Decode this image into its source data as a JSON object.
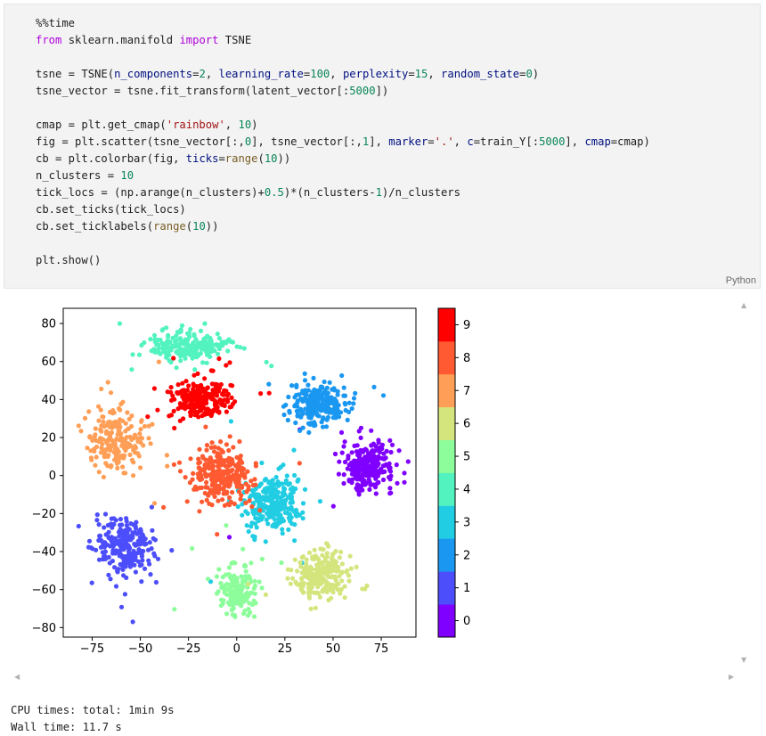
{
  "cell": {
    "language": "Python",
    "lines": [
      [
        {
          "t": "%%time",
          "c": ""
        }
      ],
      [
        {
          "t": "from",
          "c": "kw"
        },
        {
          "t": " sklearn.manifold ",
          "c": ""
        },
        {
          "t": "import",
          "c": "kw"
        },
        {
          "t": " TSNE",
          "c": ""
        }
      ],
      [],
      [
        {
          "t": "tsne = TSNE(",
          "c": ""
        },
        {
          "t": "n_components",
          "c": "nm"
        },
        {
          "t": "=",
          "c": ""
        },
        {
          "t": "2",
          "c": "num"
        },
        {
          "t": ", ",
          "c": ""
        },
        {
          "t": "learning_rate",
          "c": "nm"
        },
        {
          "t": "=",
          "c": ""
        },
        {
          "t": "100",
          "c": "num"
        },
        {
          "t": ", ",
          "c": ""
        },
        {
          "t": "perplexity",
          "c": "nm"
        },
        {
          "t": "=",
          "c": ""
        },
        {
          "t": "15",
          "c": "num"
        },
        {
          "t": ", ",
          "c": ""
        },
        {
          "t": "random_state",
          "c": "nm"
        },
        {
          "t": "=",
          "c": ""
        },
        {
          "t": "0",
          "c": "num"
        },
        {
          "t": ")",
          "c": ""
        }
      ],
      [
        {
          "t": "tsne_vector = tsne.fit_transform(latent_vector[:",
          "c": ""
        },
        {
          "t": "5000",
          "c": "num"
        },
        {
          "t": "])",
          "c": ""
        }
      ],
      [],
      [
        {
          "t": "cmap = plt.get_cmap(",
          "c": ""
        },
        {
          "t": "'rainbow'",
          "c": "str"
        },
        {
          "t": ", ",
          "c": ""
        },
        {
          "t": "10",
          "c": "num"
        },
        {
          "t": ")",
          "c": ""
        }
      ],
      [
        {
          "t": "fig = plt.scatter(tsne_vector[:,",
          "c": ""
        },
        {
          "t": "0",
          "c": "num"
        },
        {
          "t": "], tsne_vector[:,",
          "c": ""
        },
        {
          "t": "1",
          "c": "num"
        },
        {
          "t": "], ",
          "c": ""
        },
        {
          "t": "marker",
          "c": "nm"
        },
        {
          "t": "=",
          "c": ""
        },
        {
          "t": "'.'",
          "c": "str"
        },
        {
          "t": ", ",
          "c": ""
        },
        {
          "t": "c",
          "c": "nm"
        },
        {
          "t": "=train_Y[:",
          "c": ""
        },
        {
          "t": "5000",
          "c": "num"
        },
        {
          "t": "], ",
          "c": ""
        },
        {
          "t": "cmap",
          "c": "nm"
        },
        {
          "t": "=cmap)",
          "c": ""
        }
      ],
      [
        {
          "t": "cb = plt.colorbar(fig, ",
          "c": ""
        },
        {
          "t": "ticks",
          "c": "nm"
        },
        {
          "t": "=",
          "c": ""
        },
        {
          "t": "range",
          "c": "fn"
        },
        {
          "t": "(",
          "c": ""
        },
        {
          "t": "10",
          "c": "num"
        },
        {
          "t": "))",
          "c": ""
        }
      ],
      [
        {
          "t": "n_clusters = ",
          "c": ""
        },
        {
          "t": "10",
          "c": "num"
        }
      ],
      [
        {
          "t": "tick_locs = (np.arange(n_clusters)+",
          "c": ""
        },
        {
          "t": "0.5",
          "c": "num"
        },
        {
          "t": ")*(n_clusters-",
          "c": ""
        },
        {
          "t": "1",
          "c": "num"
        },
        {
          "t": ")/n_clusters",
          "c": ""
        }
      ],
      [
        {
          "t": "cb.set_ticks(tick_locs)",
          "c": ""
        }
      ],
      [
        {
          "t": "cb.set_ticklabels(",
          "c": ""
        },
        {
          "t": "range",
          "c": "fn"
        },
        {
          "t": "(",
          "c": ""
        },
        {
          "t": "10",
          "c": "num"
        },
        {
          "t": "))",
          "c": ""
        }
      ],
      [],
      [
        {
          "t": "plt.show()",
          "c": ""
        }
      ]
    ]
  },
  "stdout": [
    "CPU times: total: 1min 9s",
    "Wall time: 11.7 s"
  ],
  "colors": {
    "rainbow10": [
      "#8000ff",
      "#4c4efc",
      "#1a97f0",
      "#21cde3",
      "#52f3bf",
      "#8cfd9a",
      "#d4e57d",
      "#ff9f57",
      "#ff5a31",
      "#ff0000"
    ]
  },
  "chart_data": {
    "type": "scatter",
    "title": "",
    "xlabel": "",
    "ylabel": "",
    "xlim": [
      -90,
      93
    ],
    "ylim": [
      -85,
      88
    ],
    "xticks": [
      -75,
      -50,
      -25,
      0,
      25,
      50,
      75
    ],
    "yticks": [
      80,
      60,
      40,
      20,
      0,
      -20,
      -40,
      -60,
      -80
    ],
    "colorbar": {
      "labels": [
        "0",
        "1",
        "2",
        "3",
        "4",
        "5",
        "6",
        "7",
        "8",
        "9"
      ]
    },
    "clusters": [
      {
        "label": 0,
        "center": [
          68,
          5
        ],
        "spread": [
          12,
          11
        ],
        "n": 260
      },
      {
        "label": 1,
        "center": [
          -58,
          -38
        ],
        "spread": [
          14,
          14
        ],
        "n": 240
      },
      {
        "label": 2,
        "center": [
          42,
          38
        ],
        "spread": [
          13,
          10
        ],
        "n": 220
      },
      {
        "label": 3,
        "center": [
          18,
          -15
        ],
        "spread": [
          14,
          13
        ],
        "n": 260
      },
      {
        "label": 4,
        "center": [
          -25,
          68
        ],
        "spread": [
          18,
          7
        ],
        "n": 210
      },
      {
        "label": 5,
        "center": [
          0,
          -60
        ],
        "spread": [
          9,
          12
        ],
        "n": 150
      },
      {
        "label": 6,
        "center": [
          45,
          -52
        ],
        "spread": [
          14,
          11
        ],
        "n": 220
      },
      {
        "label": 7,
        "center": [
          -62,
          18
        ],
        "spread": [
          13,
          14
        ],
        "n": 200
      },
      {
        "label": 8,
        "center": [
          -8,
          0
        ],
        "spread": [
          14,
          13
        ],
        "n": 260
      },
      {
        "label": 9,
        "center": [
          -20,
          40
        ],
        "spread": [
          14,
          9
        ],
        "n": 230
      }
    ]
  }
}
